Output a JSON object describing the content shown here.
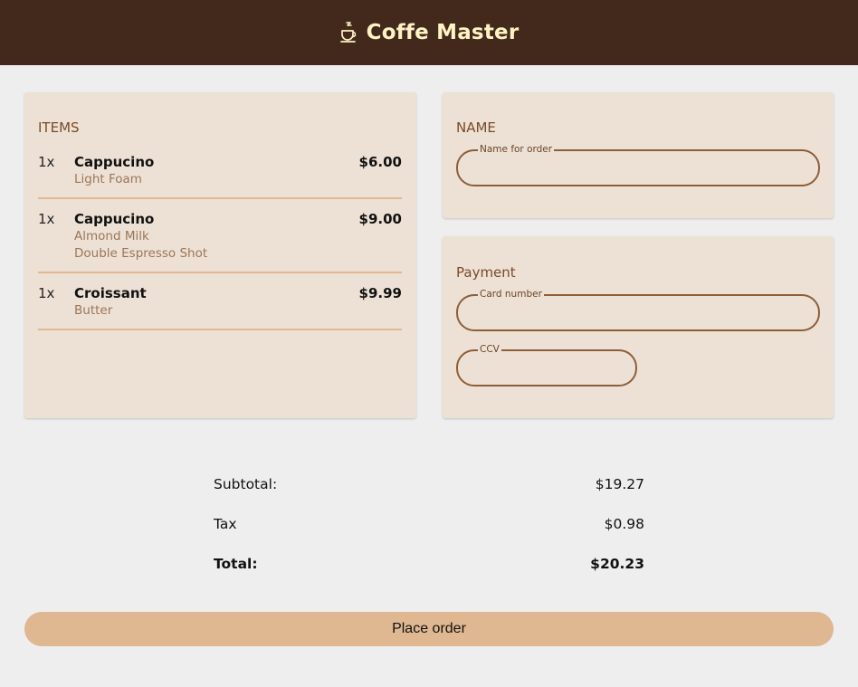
{
  "header": {
    "title": "Coffe Master",
    "logo_icon": "coffee-cup-icon",
    "background_color": "#43291c",
    "title_color": "#fff3c4"
  },
  "items_section": {
    "title": "ITEMS",
    "items": [
      {
        "qty": "1x",
        "name": "Cappucino",
        "price": "$6.00",
        "options": [
          "Light Foam"
        ]
      },
      {
        "qty": "1x",
        "name": "Cappucino",
        "price": "$9.00",
        "options": [
          "Almond Milk",
          "Double Espresso Shot"
        ]
      },
      {
        "qty": "1x",
        "name": "Croissant",
        "price": "$9.99",
        "options": [
          "Butter"
        ]
      }
    ]
  },
  "name_section": {
    "title": "NAME",
    "name_field": {
      "label": "Name for order",
      "value": ""
    }
  },
  "payment_section": {
    "title": "Payment",
    "card_field": {
      "label": "Card number",
      "value": ""
    },
    "ccv_field": {
      "label": "CCV",
      "value": ""
    }
  },
  "totals": {
    "subtotal_label": "Subtotal:",
    "subtotal_value": "$19.27",
    "tax_label": "Tax",
    "tax_value": "$0.98",
    "total_label": "Total:",
    "total_value": "$20.23"
  },
  "actions": {
    "place_order_label": "Place order",
    "button_color": "#dfb791"
  },
  "theme": {
    "card_background": "#ede1d6",
    "accent_brown": "#8e5e36",
    "divider_color": "#e2b891"
  }
}
